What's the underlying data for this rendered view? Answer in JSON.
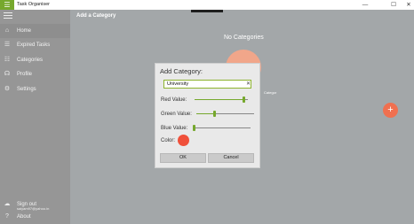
{
  "window": {
    "title": "Task Organiser",
    "min_glyph": "—",
    "max_glyph": "☐",
    "close_glyph": "✕"
  },
  "sidebar": {
    "menu_icon": "hamburger-icon",
    "items": [
      {
        "label": "Home",
        "icon": "home-icon",
        "glyph": "⌂",
        "active": true
      },
      {
        "label": "Expired Tasks",
        "icon": "list-icon",
        "glyph": "☰",
        "active": false
      },
      {
        "label": "Categories",
        "icon": "category-icon",
        "glyph": "☷",
        "active": false
      },
      {
        "label": "Profile",
        "icon": "contact-card-icon",
        "glyph": "☊",
        "active": false
      },
      {
        "label": "Settings",
        "icon": "gear-icon",
        "glyph": "⚙",
        "active": false
      }
    ],
    "account_email": "saiyam97@yahoo.in",
    "sign_out_label": "Sign out",
    "about_label": "About",
    "sign_out_glyph": "☁",
    "about_glyph": "?"
  },
  "main": {
    "page_title": "Add a Category",
    "empty_title": "No Categories",
    "empty_hint": "Categor",
    "fab_glyph": "+"
  },
  "dialog": {
    "title": "Add Category:",
    "input_value": "University",
    "clear_glyph": "✕",
    "red_label": "Red Value:",
    "green_label": "Green Value:",
    "blue_label": "Blue Value:",
    "red_value": 240,
    "green_value": 80,
    "blue_value": 0,
    "slider_max": 255,
    "color_label": "Color:",
    "color_hex": "#f0503a",
    "ok_label": "OK",
    "cancel_label": "Cancel"
  },
  "colors": {
    "accent": "#76a82d",
    "sidebar": "#969696",
    "main_bg": "#a3a7a9",
    "fab": "#f07050"
  }
}
